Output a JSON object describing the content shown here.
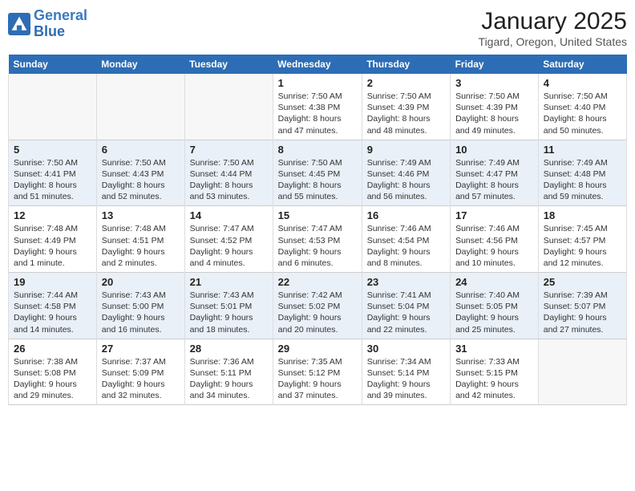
{
  "header": {
    "logo_line1": "General",
    "logo_line2": "Blue",
    "month_year": "January 2025",
    "location": "Tigard, Oregon, United States"
  },
  "weekdays": [
    "Sunday",
    "Monday",
    "Tuesday",
    "Wednesday",
    "Thursday",
    "Friday",
    "Saturday"
  ],
  "weeks": [
    [
      {
        "day": "",
        "sunrise": "",
        "sunset": "",
        "daylight": ""
      },
      {
        "day": "",
        "sunrise": "",
        "sunset": "",
        "daylight": ""
      },
      {
        "day": "",
        "sunrise": "",
        "sunset": "",
        "daylight": ""
      },
      {
        "day": "1",
        "sunrise": "Sunrise: 7:50 AM",
        "sunset": "Sunset: 4:38 PM",
        "daylight": "Daylight: 8 hours and 47 minutes."
      },
      {
        "day": "2",
        "sunrise": "Sunrise: 7:50 AM",
        "sunset": "Sunset: 4:39 PM",
        "daylight": "Daylight: 8 hours and 48 minutes."
      },
      {
        "day": "3",
        "sunrise": "Sunrise: 7:50 AM",
        "sunset": "Sunset: 4:39 PM",
        "daylight": "Daylight: 8 hours and 49 minutes."
      },
      {
        "day": "4",
        "sunrise": "Sunrise: 7:50 AM",
        "sunset": "Sunset: 4:40 PM",
        "daylight": "Daylight: 8 hours and 50 minutes."
      }
    ],
    [
      {
        "day": "5",
        "sunrise": "Sunrise: 7:50 AM",
        "sunset": "Sunset: 4:41 PM",
        "daylight": "Daylight: 8 hours and 51 minutes."
      },
      {
        "day": "6",
        "sunrise": "Sunrise: 7:50 AM",
        "sunset": "Sunset: 4:43 PM",
        "daylight": "Daylight: 8 hours and 52 minutes."
      },
      {
        "day": "7",
        "sunrise": "Sunrise: 7:50 AM",
        "sunset": "Sunset: 4:44 PM",
        "daylight": "Daylight: 8 hours and 53 minutes."
      },
      {
        "day": "8",
        "sunrise": "Sunrise: 7:50 AM",
        "sunset": "Sunset: 4:45 PM",
        "daylight": "Daylight: 8 hours and 55 minutes."
      },
      {
        "day": "9",
        "sunrise": "Sunrise: 7:49 AM",
        "sunset": "Sunset: 4:46 PM",
        "daylight": "Daylight: 8 hours and 56 minutes."
      },
      {
        "day": "10",
        "sunrise": "Sunrise: 7:49 AM",
        "sunset": "Sunset: 4:47 PM",
        "daylight": "Daylight: 8 hours and 57 minutes."
      },
      {
        "day": "11",
        "sunrise": "Sunrise: 7:49 AM",
        "sunset": "Sunset: 4:48 PM",
        "daylight": "Daylight: 8 hours and 59 minutes."
      }
    ],
    [
      {
        "day": "12",
        "sunrise": "Sunrise: 7:48 AM",
        "sunset": "Sunset: 4:49 PM",
        "daylight": "Daylight: 9 hours and 1 minute."
      },
      {
        "day": "13",
        "sunrise": "Sunrise: 7:48 AM",
        "sunset": "Sunset: 4:51 PM",
        "daylight": "Daylight: 9 hours and 2 minutes."
      },
      {
        "day": "14",
        "sunrise": "Sunrise: 7:47 AM",
        "sunset": "Sunset: 4:52 PM",
        "daylight": "Daylight: 9 hours and 4 minutes."
      },
      {
        "day": "15",
        "sunrise": "Sunrise: 7:47 AM",
        "sunset": "Sunset: 4:53 PM",
        "daylight": "Daylight: 9 hours and 6 minutes."
      },
      {
        "day": "16",
        "sunrise": "Sunrise: 7:46 AM",
        "sunset": "Sunset: 4:54 PM",
        "daylight": "Daylight: 9 hours and 8 minutes."
      },
      {
        "day": "17",
        "sunrise": "Sunrise: 7:46 AM",
        "sunset": "Sunset: 4:56 PM",
        "daylight": "Daylight: 9 hours and 10 minutes."
      },
      {
        "day": "18",
        "sunrise": "Sunrise: 7:45 AM",
        "sunset": "Sunset: 4:57 PM",
        "daylight": "Daylight: 9 hours and 12 minutes."
      }
    ],
    [
      {
        "day": "19",
        "sunrise": "Sunrise: 7:44 AM",
        "sunset": "Sunset: 4:58 PM",
        "daylight": "Daylight: 9 hours and 14 minutes."
      },
      {
        "day": "20",
        "sunrise": "Sunrise: 7:43 AM",
        "sunset": "Sunset: 5:00 PM",
        "daylight": "Daylight: 9 hours and 16 minutes."
      },
      {
        "day": "21",
        "sunrise": "Sunrise: 7:43 AM",
        "sunset": "Sunset: 5:01 PM",
        "daylight": "Daylight: 9 hours and 18 minutes."
      },
      {
        "day": "22",
        "sunrise": "Sunrise: 7:42 AM",
        "sunset": "Sunset: 5:02 PM",
        "daylight": "Daylight: 9 hours and 20 minutes."
      },
      {
        "day": "23",
        "sunrise": "Sunrise: 7:41 AM",
        "sunset": "Sunset: 5:04 PM",
        "daylight": "Daylight: 9 hours and 22 minutes."
      },
      {
        "day": "24",
        "sunrise": "Sunrise: 7:40 AM",
        "sunset": "Sunset: 5:05 PM",
        "daylight": "Daylight: 9 hours and 25 minutes."
      },
      {
        "day": "25",
        "sunrise": "Sunrise: 7:39 AM",
        "sunset": "Sunset: 5:07 PM",
        "daylight": "Daylight: 9 hours and 27 minutes."
      }
    ],
    [
      {
        "day": "26",
        "sunrise": "Sunrise: 7:38 AM",
        "sunset": "Sunset: 5:08 PM",
        "daylight": "Daylight: 9 hours and 29 minutes."
      },
      {
        "day": "27",
        "sunrise": "Sunrise: 7:37 AM",
        "sunset": "Sunset: 5:09 PM",
        "daylight": "Daylight: 9 hours and 32 minutes."
      },
      {
        "day": "28",
        "sunrise": "Sunrise: 7:36 AM",
        "sunset": "Sunset: 5:11 PM",
        "daylight": "Daylight: 9 hours and 34 minutes."
      },
      {
        "day": "29",
        "sunrise": "Sunrise: 7:35 AM",
        "sunset": "Sunset: 5:12 PM",
        "daylight": "Daylight: 9 hours and 37 minutes."
      },
      {
        "day": "30",
        "sunrise": "Sunrise: 7:34 AM",
        "sunset": "Sunset: 5:14 PM",
        "daylight": "Daylight: 9 hours and 39 minutes."
      },
      {
        "day": "31",
        "sunrise": "Sunrise: 7:33 AM",
        "sunset": "Sunset: 5:15 PM",
        "daylight": "Daylight: 9 hours and 42 minutes."
      },
      {
        "day": "",
        "sunrise": "",
        "sunset": "",
        "daylight": ""
      }
    ]
  ]
}
